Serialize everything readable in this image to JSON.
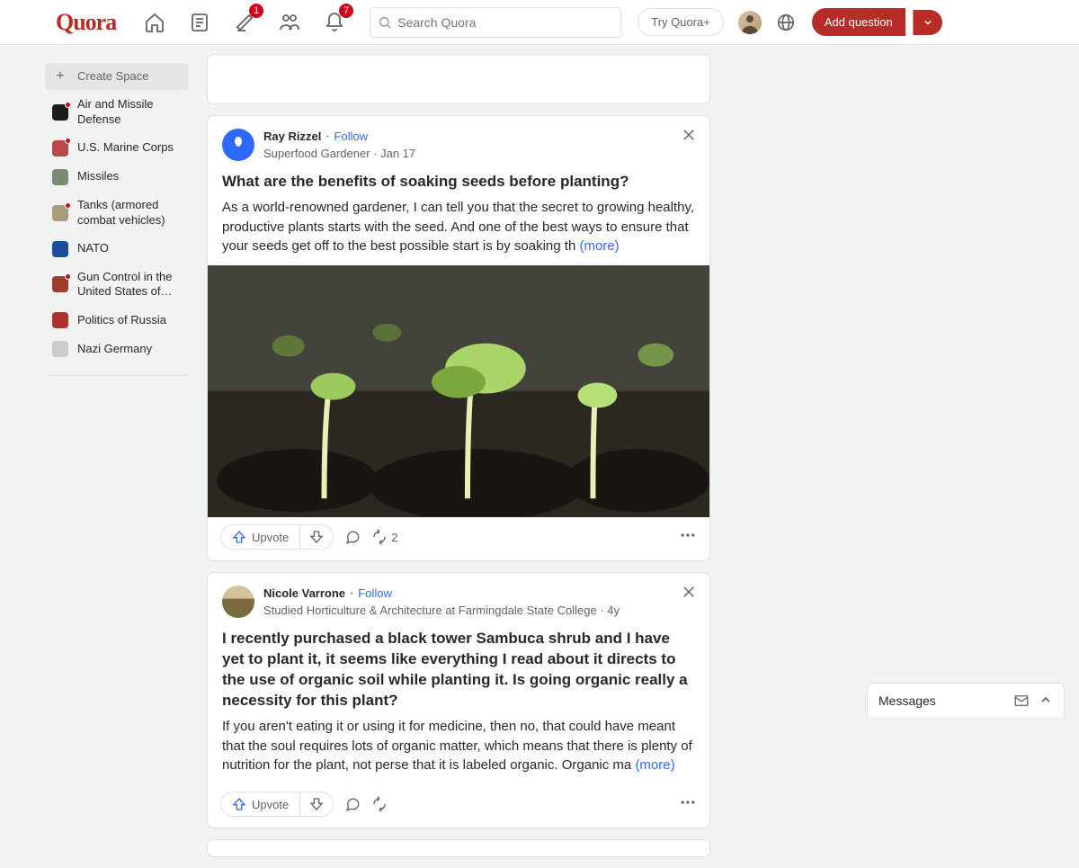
{
  "header": {
    "logo": "Quora",
    "search_placeholder": "Search Quora",
    "try_plus": "Try Quora+",
    "add_question": "Add question",
    "badges": {
      "edit": "1",
      "bell": "7"
    }
  },
  "sidebar": {
    "create": "Create Space",
    "items": [
      {
        "label": "Air and Missile Defense",
        "dot": true,
        "color": "#1a1a1a"
      },
      {
        "label": "U.S. Marine Corps",
        "dot": true,
        "color": "#b94a48"
      },
      {
        "label": "Missiles",
        "dot": false,
        "color": "#7a8b6f"
      },
      {
        "label": "Tanks (armored combat vehicles)",
        "dot": true,
        "color": "#a89c7c"
      },
      {
        "label": "NATO",
        "dot": false,
        "color": "#1b4f9b"
      },
      {
        "label": "Gun Control in the United States of…",
        "dot": true,
        "color": "#9c3d2e"
      },
      {
        "label": "Politics of Russia",
        "dot": false,
        "color": "#b03030"
      },
      {
        "label": "Nazi Germany",
        "dot": false,
        "color": "#cccccc"
      }
    ]
  },
  "posts": [
    {
      "author": "Ray Rizzel",
      "follow": "Follow",
      "sub": "Superfood Gardener",
      "date": "Jan 17",
      "title": "What are the benefits of soaking seeds before planting?",
      "body": "As a world-renowned gardener, I can tell you that the secret to growing healthy, productive plants starts with the seed. And one of the best ways to ensure that your seeds get off to the best possible start is by soaking th",
      "more": "(more)",
      "upvote": "Upvote",
      "shares": "2"
    },
    {
      "author": "Nicole Varrone",
      "follow": "Follow",
      "sub": "Studied Horticulture & Architecture at Farmingdale State College",
      "date": "4y",
      "title": "I recently purchased a black tower Sambuca shrub and I have yet to plant it, it seems like everything I read about it directs to the use of organic soil while planting it. Is going organic really a necessity for this plant?",
      "body": "If you aren't eating it or using it for medicine, then no, that could have meant that the soul requires lots of organic matter, which means that there is plenty of nutrition for the plant, not perse that it is labeled organic. Organic ma",
      "more": "(more)",
      "upvote": "Upvote"
    }
  ],
  "messages": {
    "title": "Messages"
  }
}
